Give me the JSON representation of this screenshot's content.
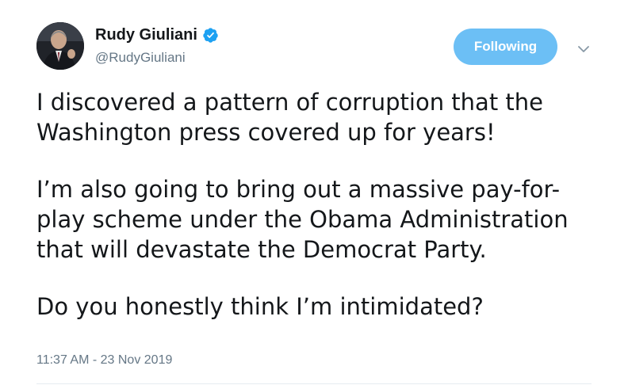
{
  "author": {
    "display_name": "Rudy Giuliani",
    "handle": "@RudyGiuliani",
    "verified": true
  },
  "follow_button": {
    "label": "Following"
  },
  "tweet": {
    "lines": [
      [
        "I discovered a pattern of corruption that the",
        "Washington press covered up for years!"
      ],
      [
        "I’m also going to bring out a massive pay-for-",
        "play scheme under the Obama Administration",
        "that will devastate the Democrat Party."
      ],
      [
        "Do you honestly think I’m intimidated?"
      ]
    ]
  },
  "timestamp": "11:37 AM - 23 Nov 2019",
  "icons": {
    "verified": "verified-badge-icon",
    "caret": "chevron-down-icon"
  },
  "colors": {
    "accent": "#1da1f2",
    "follow_button_bg": "#6cbff5",
    "secondary_text": "#657786",
    "primary_text": "#14171a"
  }
}
